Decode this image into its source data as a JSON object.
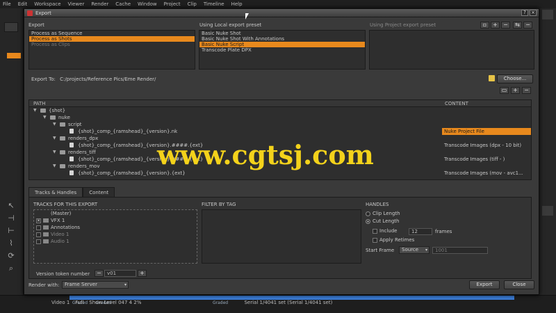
{
  "menubar": [
    "File",
    "Edit",
    "Workspace",
    "Viewer",
    "Render",
    "Cache",
    "Window",
    "Project",
    "Clip",
    "Timeline",
    "Help"
  ],
  "dialog": {
    "title": "Export",
    "title_buttons": [
      "?",
      "×"
    ]
  },
  "export_section": {
    "label": "Export",
    "items": [
      "Process as Sequence",
      "Process as Shots",
      "Process as Clips"
    ],
    "selected_index": 1
  },
  "local_preset": {
    "label": "Using Local export preset",
    "items": [
      "Basic Nuke Shot",
      "Basic Nuke Shot With Annotations",
      "Basic Nuke Script",
      "Transcode Plate DPX"
    ],
    "selected_index": 2
  },
  "project_preset": {
    "label": "Using Project export preset"
  },
  "export_to": {
    "label": "Export To:",
    "path": "C:/projects/Reference Pics/Eme Render/",
    "choose_label": "Choose..."
  },
  "tree": {
    "col_path": "PATH",
    "col_content": "CONTENT",
    "rows": [
      {
        "indent": 0,
        "arrow": "▼",
        "kind": "folder",
        "path": "{shot}",
        "content": "",
        "highlight": false
      },
      {
        "indent": 1,
        "arrow": "▼",
        "kind": "folder",
        "path": "nuke",
        "content": "",
        "highlight": false
      },
      {
        "indent": 2,
        "arrow": "▼",
        "kind": "folder",
        "path": "script",
        "content": "",
        "highlight": false
      },
      {
        "indent": 3,
        "arrow": "",
        "kind": "file",
        "path": "{shot}_comp_{ramshead}_{version}.nk",
        "content": "Nuke Project File",
        "highlight": true
      },
      {
        "indent": 2,
        "arrow": "▼",
        "kind": "folder",
        "path": "renders_dpx",
        "content": "",
        "highlight": false
      },
      {
        "indent": 3,
        "arrow": "",
        "kind": "file",
        "path": "{shot}_comp_{ramshead}_{version}.####.{ext}",
        "content": "Transcode Images (dpx - 10 bit)",
        "highlight": false
      },
      {
        "indent": 2,
        "arrow": "▼",
        "kind": "folder",
        "path": "renders_tiff",
        "content": "",
        "highlight": false
      },
      {
        "indent": 3,
        "arrow": "",
        "kind": "file",
        "path": "{shot}_comp_{ramshead}_{version}.####.{ext}",
        "content": "Transcode Images (tiff - )",
        "highlight": false
      },
      {
        "indent": 2,
        "arrow": "▼",
        "kind": "folder",
        "path": "renders_mov",
        "content": "",
        "highlight": false
      },
      {
        "indent": 3,
        "arrow": "",
        "kind": "file",
        "path": "{shot}_comp_{ramshead}_{version}.{ext}",
        "content": "Transcode Images (mov - avc1...",
        "highlight": false
      }
    ]
  },
  "tabs": [
    "Tracks & Handles",
    "Content"
  ],
  "tracks_section": {
    "label": "TRACKS FOR THIS EXPORT",
    "items": [
      {
        "label": "(Master)",
        "checked": false
      },
      {
        "label": "VFX 1",
        "checked": true
      },
      {
        "label": "Annotations",
        "checked": false
      },
      {
        "label": "Video 1",
        "checked": false
      },
      {
        "label": "Audio 1",
        "checked": false
      }
    ]
  },
  "filter_section": {
    "label": "FILTER BY TAG"
  },
  "handles": {
    "label": "HANDLES",
    "clip_length": "Clip Length",
    "cut_length": "Cut Length",
    "include_label": "Include",
    "include_value": "12",
    "frames_label": "frames",
    "apply_retimes": "Apply Retimes",
    "start_frame_label": "Start Frame",
    "start_frame_mode": "Source",
    "start_frame_value": "1001"
  },
  "version_section": {
    "label": "Version token number",
    "value": "v01"
  },
  "render_with": {
    "label": "Render with:",
    "value": "Frame Server"
  },
  "actions": {
    "export": "Export",
    "close": "Close"
  },
  "timeline": {
    "labels": [
      "Graded",
      "Graded",
      "Graded"
    ],
    "bottom": [
      "Video 1",
      "Full",
      "Show Level 047 4 2%",
      "Serial 1/4041 set (Serial 1/4041 set)"
    ]
  },
  "watermark": "www.cgtsj.com"
}
